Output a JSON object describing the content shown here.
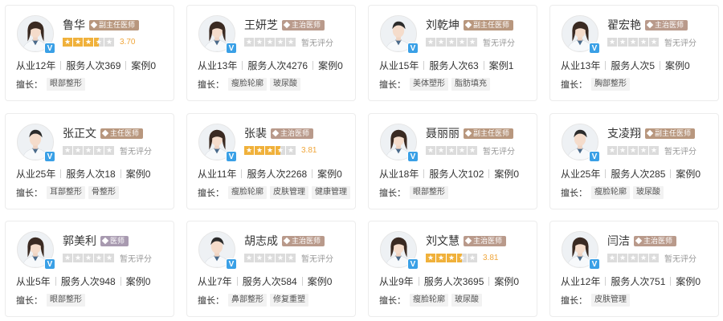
{
  "labels": {
    "skill_prefix": "擅长：",
    "verify_mark": "V"
  },
  "colors": {
    "star_on": "#f0b13b",
    "star_off": "#dcdcdc",
    "verify": "#3aa0e6",
    "badge": "#b99a8b"
  },
  "doctors": [
    {
      "name": "鲁华",
      "title": "副主任医师",
      "title_kind": "chief",
      "rating_stars": 3.5,
      "score": "3.70",
      "years": "从业12年",
      "services": "服务人次369",
      "cases": "案例0",
      "skills": [
        "眼部整形"
      ],
      "gender": "female"
    },
    {
      "name": "王妍芝",
      "title": "主治医师",
      "title_kind": "attending",
      "rating_stars": 0,
      "score": "暂无评分",
      "years": "从业13年",
      "services": "服务人次4276",
      "cases": "案例0",
      "skills": [
        "瘦脸轮廓",
        "玻尿酸"
      ],
      "gender": "female"
    },
    {
      "name": "刘乾坤",
      "title": "副主任医师",
      "title_kind": "chief",
      "rating_stars": 0,
      "score": "暂无评分",
      "years": "从业15年",
      "services": "服务人次63",
      "cases": "案例1",
      "skills": [
        "美体塑形",
        "脂肪填充"
      ],
      "gender": "male"
    },
    {
      "name": "翟宏艳",
      "title": "主治医师",
      "title_kind": "attending",
      "rating_stars": 0,
      "score": "暂无评分",
      "years": "从业13年",
      "services": "服务人次5",
      "cases": "案例0",
      "skills": [
        "胸部整形"
      ],
      "gender": "female"
    },
    {
      "name": "张正文",
      "title": "主任医师",
      "title_kind": "chief",
      "rating_stars": 0,
      "score": "暂无评分",
      "years": "从业25年",
      "services": "服务人次18",
      "cases": "案例0",
      "skills": [
        "耳部整形",
        "骨整形"
      ],
      "gender": "male"
    },
    {
      "name": "张裴",
      "title": "主治医师",
      "title_kind": "attending",
      "rating_stars": 3.5,
      "score": "3.81",
      "years": "从业11年",
      "services": "服务人次2268",
      "cases": "案例0",
      "skills": [
        "瘦脸轮廓",
        "皮肤管理",
        "健康管理"
      ],
      "gender": "female"
    },
    {
      "name": "聂丽丽",
      "title": "副主任医师",
      "title_kind": "chief",
      "rating_stars": 0,
      "score": "暂无评分",
      "years": "从业18年",
      "services": "服务人次102",
      "cases": "案例0",
      "skills": [
        "眼部整形"
      ],
      "gender": "female"
    },
    {
      "name": "支凌翔",
      "title": "副主任医师",
      "title_kind": "chief",
      "rating_stars": 0,
      "score": "暂无评分",
      "years": "从业25年",
      "services": "服务人次285",
      "cases": "案例0",
      "skills": [
        "瘦脸轮廓",
        "玻尿酸"
      ],
      "gender": "male"
    },
    {
      "name": "郭美利",
      "title": "医师",
      "title_kind": "plain",
      "rating_stars": 0,
      "score": "暂无评分",
      "years": "从业5年",
      "services": "服务人次948",
      "cases": "案例0",
      "skills": [
        "眼部整形"
      ],
      "gender": "female"
    },
    {
      "name": "胡志成",
      "title": "主治医师",
      "title_kind": "attending",
      "rating_stars": 0,
      "score": "暂无评分",
      "years": "从业7年",
      "services": "服务人次584",
      "cases": "案例0",
      "skills": [
        "鼻部整形",
        "修复重塑"
      ],
      "gender": "male"
    },
    {
      "name": "刘文慧",
      "title": "主治医师",
      "title_kind": "attending",
      "rating_stars": 3.5,
      "score": "3.81",
      "years": "从业9年",
      "services": "服务人次3695",
      "cases": "案例0",
      "skills": [
        "瘦脸轮廓",
        "玻尿酸"
      ],
      "gender": "female"
    },
    {
      "name": "闫洁",
      "title": "主治医师",
      "title_kind": "attending",
      "rating_stars": 0,
      "score": "暂无评分",
      "years": "从业12年",
      "services": "服务人次751",
      "cases": "案例0",
      "skills": [
        "皮肤管理"
      ],
      "gender": "female"
    }
  ]
}
